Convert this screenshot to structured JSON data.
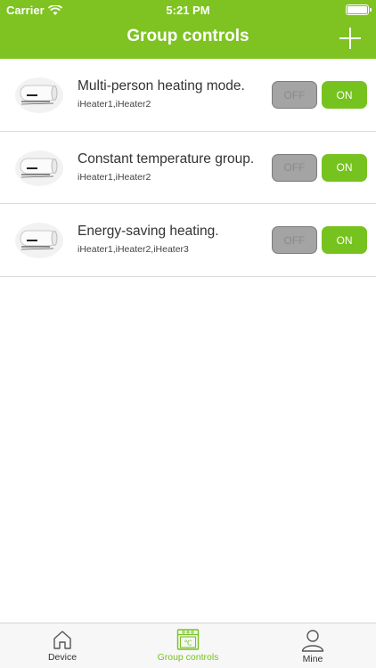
{
  "status_bar": {
    "carrier": "Carrier",
    "time": "5:21 PM"
  },
  "nav": {
    "title": "Group controls",
    "add_icon": "plus-icon"
  },
  "groups": [
    {
      "name": "Multi-person heating mode.",
      "members": "iHeater1,iHeater2",
      "off_label": "OFF",
      "on_label": "ON"
    },
    {
      "name": "Constant temperature group.",
      "members": "iHeater1,iHeater2",
      "off_label": "OFF",
      "on_label": "ON"
    },
    {
      "name": "Energy-saving heating.",
      "members": "iHeater1,iHeater2,iHeater3",
      "off_label": "OFF",
      "on_label": "ON"
    }
  ],
  "tabbar": {
    "tabs": [
      {
        "label": "Device",
        "icon": "home-icon"
      },
      {
        "label": "Group controls",
        "icon": "oven-icon",
        "selected": true
      },
      {
        "label": "Mine",
        "icon": "person-icon"
      }
    ]
  },
  "colors": {
    "brand": "#7ec322",
    "on": "#76c21f",
    "off": "#a4a4a4"
  }
}
